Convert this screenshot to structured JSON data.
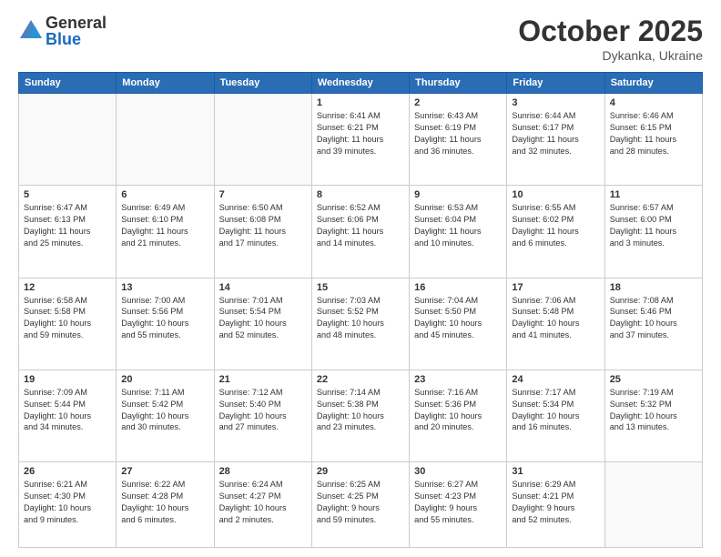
{
  "header": {
    "logo_general": "General",
    "logo_blue": "Blue",
    "month": "October 2025",
    "location": "Dykanka, Ukraine"
  },
  "weekdays": [
    "Sunday",
    "Monday",
    "Tuesday",
    "Wednesday",
    "Thursday",
    "Friday",
    "Saturday"
  ],
  "weeks": [
    [
      {
        "day": "",
        "info": ""
      },
      {
        "day": "",
        "info": ""
      },
      {
        "day": "",
        "info": ""
      },
      {
        "day": "1",
        "info": "Sunrise: 6:41 AM\nSunset: 6:21 PM\nDaylight: 11 hours\nand 39 minutes."
      },
      {
        "day": "2",
        "info": "Sunrise: 6:43 AM\nSunset: 6:19 PM\nDaylight: 11 hours\nand 36 minutes."
      },
      {
        "day": "3",
        "info": "Sunrise: 6:44 AM\nSunset: 6:17 PM\nDaylight: 11 hours\nand 32 minutes."
      },
      {
        "day": "4",
        "info": "Sunrise: 6:46 AM\nSunset: 6:15 PM\nDaylight: 11 hours\nand 28 minutes."
      }
    ],
    [
      {
        "day": "5",
        "info": "Sunrise: 6:47 AM\nSunset: 6:13 PM\nDaylight: 11 hours\nand 25 minutes."
      },
      {
        "day": "6",
        "info": "Sunrise: 6:49 AM\nSunset: 6:10 PM\nDaylight: 11 hours\nand 21 minutes."
      },
      {
        "day": "7",
        "info": "Sunrise: 6:50 AM\nSunset: 6:08 PM\nDaylight: 11 hours\nand 17 minutes."
      },
      {
        "day": "8",
        "info": "Sunrise: 6:52 AM\nSunset: 6:06 PM\nDaylight: 11 hours\nand 14 minutes."
      },
      {
        "day": "9",
        "info": "Sunrise: 6:53 AM\nSunset: 6:04 PM\nDaylight: 11 hours\nand 10 minutes."
      },
      {
        "day": "10",
        "info": "Sunrise: 6:55 AM\nSunset: 6:02 PM\nDaylight: 11 hours\nand 6 minutes."
      },
      {
        "day": "11",
        "info": "Sunrise: 6:57 AM\nSunset: 6:00 PM\nDaylight: 11 hours\nand 3 minutes."
      }
    ],
    [
      {
        "day": "12",
        "info": "Sunrise: 6:58 AM\nSunset: 5:58 PM\nDaylight: 10 hours\nand 59 minutes."
      },
      {
        "day": "13",
        "info": "Sunrise: 7:00 AM\nSunset: 5:56 PM\nDaylight: 10 hours\nand 55 minutes."
      },
      {
        "day": "14",
        "info": "Sunrise: 7:01 AM\nSunset: 5:54 PM\nDaylight: 10 hours\nand 52 minutes."
      },
      {
        "day": "15",
        "info": "Sunrise: 7:03 AM\nSunset: 5:52 PM\nDaylight: 10 hours\nand 48 minutes."
      },
      {
        "day": "16",
        "info": "Sunrise: 7:04 AM\nSunset: 5:50 PM\nDaylight: 10 hours\nand 45 minutes."
      },
      {
        "day": "17",
        "info": "Sunrise: 7:06 AM\nSunset: 5:48 PM\nDaylight: 10 hours\nand 41 minutes."
      },
      {
        "day": "18",
        "info": "Sunrise: 7:08 AM\nSunset: 5:46 PM\nDaylight: 10 hours\nand 37 minutes."
      }
    ],
    [
      {
        "day": "19",
        "info": "Sunrise: 7:09 AM\nSunset: 5:44 PM\nDaylight: 10 hours\nand 34 minutes."
      },
      {
        "day": "20",
        "info": "Sunrise: 7:11 AM\nSunset: 5:42 PM\nDaylight: 10 hours\nand 30 minutes."
      },
      {
        "day": "21",
        "info": "Sunrise: 7:12 AM\nSunset: 5:40 PM\nDaylight: 10 hours\nand 27 minutes."
      },
      {
        "day": "22",
        "info": "Sunrise: 7:14 AM\nSunset: 5:38 PM\nDaylight: 10 hours\nand 23 minutes."
      },
      {
        "day": "23",
        "info": "Sunrise: 7:16 AM\nSunset: 5:36 PM\nDaylight: 10 hours\nand 20 minutes."
      },
      {
        "day": "24",
        "info": "Sunrise: 7:17 AM\nSunset: 5:34 PM\nDaylight: 10 hours\nand 16 minutes."
      },
      {
        "day": "25",
        "info": "Sunrise: 7:19 AM\nSunset: 5:32 PM\nDaylight: 10 hours\nand 13 minutes."
      }
    ],
    [
      {
        "day": "26",
        "info": "Sunrise: 6:21 AM\nSunset: 4:30 PM\nDaylight: 10 hours\nand 9 minutes."
      },
      {
        "day": "27",
        "info": "Sunrise: 6:22 AM\nSunset: 4:28 PM\nDaylight: 10 hours\nand 6 minutes."
      },
      {
        "day": "28",
        "info": "Sunrise: 6:24 AM\nSunset: 4:27 PM\nDaylight: 10 hours\nand 2 minutes."
      },
      {
        "day": "29",
        "info": "Sunrise: 6:25 AM\nSunset: 4:25 PM\nDaylight: 9 hours\nand 59 minutes."
      },
      {
        "day": "30",
        "info": "Sunrise: 6:27 AM\nSunset: 4:23 PM\nDaylight: 9 hours\nand 55 minutes."
      },
      {
        "day": "31",
        "info": "Sunrise: 6:29 AM\nSunset: 4:21 PM\nDaylight: 9 hours\nand 52 minutes."
      },
      {
        "day": "",
        "info": ""
      }
    ]
  ]
}
